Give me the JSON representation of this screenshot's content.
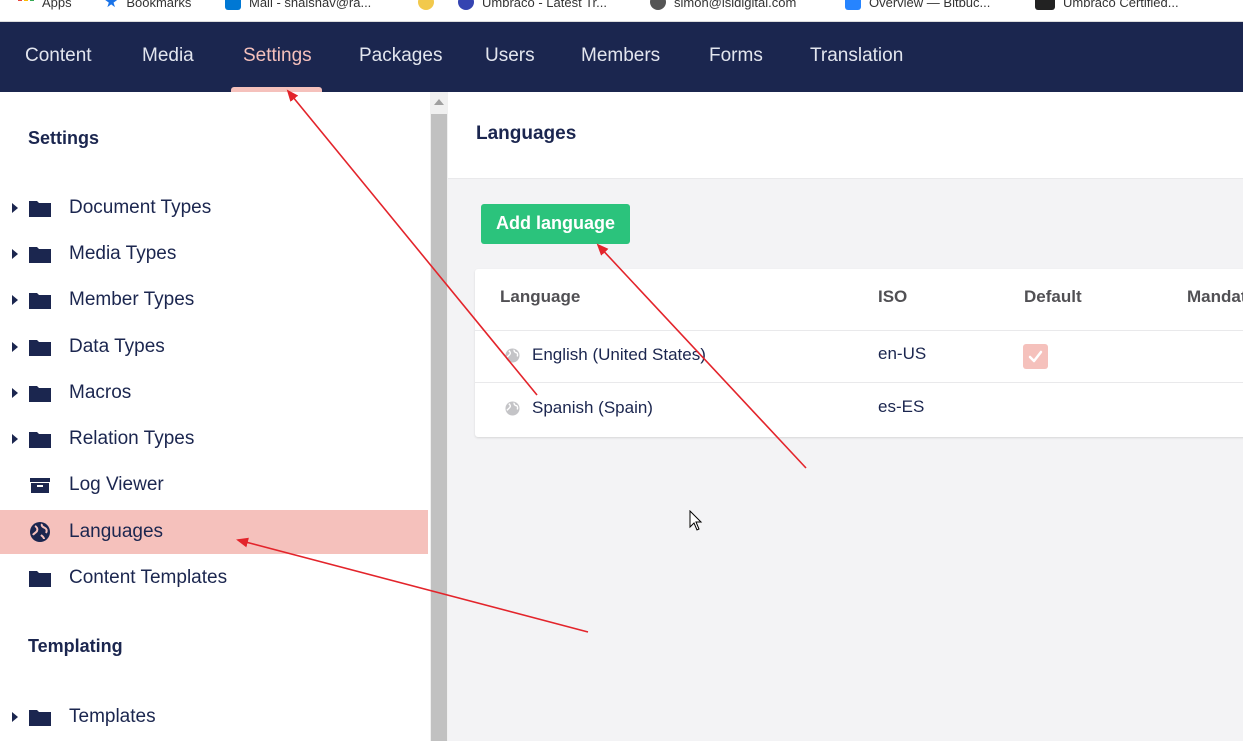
{
  "bookmarks": [
    {
      "label": "Apps",
      "color": "#e8453c"
    },
    {
      "label": "Bookmarks",
      "color": "#1a73e8"
    },
    {
      "label": "Mail - shalshav@ra...",
      "color": "#0078d4"
    },
    {
      "label": "",
      "color": "#f2c94c"
    },
    {
      "label": "Umbraco - Latest Tr...",
      "color": "#3544b1"
    },
    {
      "label": "simon@isidigital.com",
      "color": "#555555"
    },
    {
      "label": "Overview — Bitbuc...",
      "color": "#2684ff"
    },
    {
      "label": "Umbraco Certified...",
      "color": "#222222"
    }
  ],
  "nav": {
    "items": [
      "Content",
      "Media",
      "Settings",
      "Packages",
      "Users",
      "Members",
      "Forms",
      "Translation"
    ],
    "active": "Settings"
  },
  "sidebar": {
    "section_settings": "Settings",
    "items": [
      {
        "label": "Document Types",
        "icon": "folder-icon",
        "expandable": true
      },
      {
        "label": "Media Types",
        "icon": "folder-icon",
        "expandable": true
      },
      {
        "label": "Member Types",
        "icon": "folder-icon",
        "expandable": true
      },
      {
        "label": "Data Types",
        "icon": "folder-icon",
        "expandable": true
      },
      {
        "label": "Macros",
        "icon": "folder-icon",
        "expandable": true
      },
      {
        "label": "Relation Types",
        "icon": "folder-icon",
        "expandable": true
      },
      {
        "label": "Log Viewer",
        "icon": "archive-icon",
        "expandable": false
      },
      {
        "label": "Languages",
        "icon": "globe-icon",
        "expandable": false,
        "active": true
      },
      {
        "label": "Content Templates",
        "icon": "folder-icon",
        "expandable": false
      }
    ],
    "section_templating": "Templating",
    "templating_items": [
      {
        "label": "Templates",
        "icon": "folder-icon",
        "expandable": true
      }
    ]
  },
  "main": {
    "title": "Languages",
    "add_button": "Add language",
    "table": {
      "headers": [
        "Language",
        "ISO",
        "Default",
        "Mandat"
      ],
      "rows": [
        {
          "language": "English (United States)",
          "iso": "en-US",
          "default": true
        },
        {
          "language": "Spanish (Spain)",
          "iso": "es-ES",
          "default": false
        }
      ]
    }
  },
  "colors": {
    "nav_bg": "#1b264f",
    "accent_pink": "#f5c1bc",
    "button_green": "#2bc37c",
    "annotation_red": "#e3242b"
  }
}
